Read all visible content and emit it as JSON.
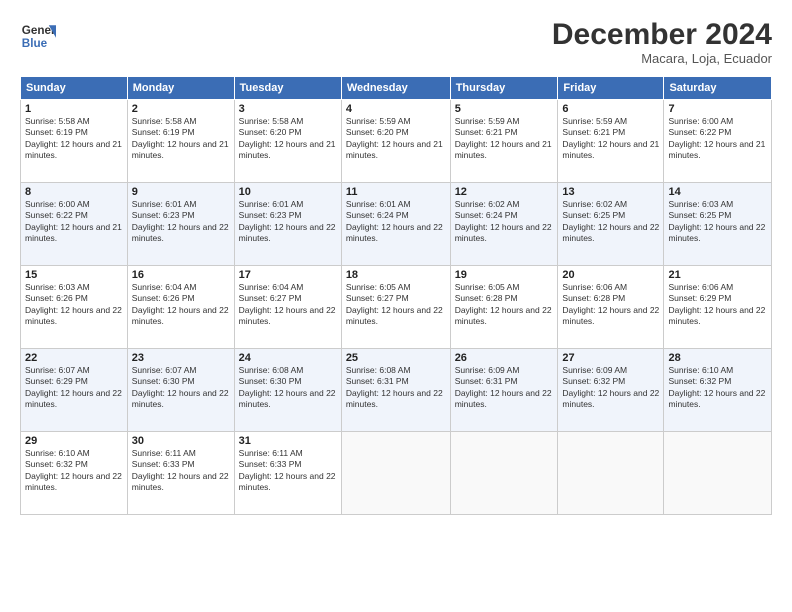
{
  "logo": {
    "line1": "General",
    "line2": "Blue"
  },
  "title": "December 2024",
  "subtitle": "Macara, Loja, Ecuador",
  "days_header": [
    "Sunday",
    "Monday",
    "Tuesday",
    "Wednesday",
    "Thursday",
    "Friday",
    "Saturday"
  ],
  "weeks": [
    [
      {
        "day": "1",
        "sunrise": "5:58 AM",
        "sunset": "6:19 PM",
        "daylight": "12 hours and 21 minutes."
      },
      {
        "day": "2",
        "sunrise": "5:58 AM",
        "sunset": "6:19 PM",
        "daylight": "12 hours and 21 minutes."
      },
      {
        "day": "3",
        "sunrise": "5:58 AM",
        "sunset": "6:20 PM",
        "daylight": "12 hours and 21 minutes."
      },
      {
        "day": "4",
        "sunrise": "5:59 AM",
        "sunset": "6:20 PM",
        "daylight": "12 hours and 21 minutes."
      },
      {
        "day": "5",
        "sunrise": "5:59 AM",
        "sunset": "6:21 PM",
        "daylight": "12 hours and 21 minutes."
      },
      {
        "day": "6",
        "sunrise": "5:59 AM",
        "sunset": "6:21 PM",
        "daylight": "12 hours and 21 minutes."
      },
      {
        "day": "7",
        "sunrise": "6:00 AM",
        "sunset": "6:22 PM",
        "daylight": "12 hours and 21 minutes."
      }
    ],
    [
      {
        "day": "8",
        "sunrise": "6:00 AM",
        "sunset": "6:22 PM",
        "daylight": "12 hours and 21 minutes."
      },
      {
        "day": "9",
        "sunrise": "6:01 AM",
        "sunset": "6:23 PM",
        "daylight": "12 hours and 22 minutes."
      },
      {
        "day": "10",
        "sunrise": "6:01 AM",
        "sunset": "6:23 PM",
        "daylight": "12 hours and 22 minutes."
      },
      {
        "day": "11",
        "sunrise": "6:01 AM",
        "sunset": "6:24 PM",
        "daylight": "12 hours and 22 minutes."
      },
      {
        "day": "12",
        "sunrise": "6:02 AM",
        "sunset": "6:24 PM",
        "daylight": "12 hours and 22 minutes."
      },
      {
        "day": "13",
        "sunrise": "6:02 AM",
        "sunset": "6:25 PM",
        "daylight": "12 hours and 22 minutes."
      },
      {
        "day": "14",
        "sunrise": "6:03 AM",
        "sunset": "6:25 PM",
        "daylight": "12 hours and 22 minutes."
      }
    ],
    [
      {
        "day": "15",
        "sunrise": "6:03 AM",
        "sunset": "6:26 PM",
        "daylight": "12 hours and 22 minutes."
      },
      {
        "day": "16",
        "sunrise": "6:04 AM",
        "sunset": "6:26 PM",
        "daylight": "12 hours and 22 minutes."
      },
      {
        "day": "17",
        "sunrise": "6:04 AM",
        "sunset": "6:27 PM",
        "daylight": "12 hours and 22 minutes."
      },
      {
        "day": "18",
        "sunrise": "6:05 AM",
        "sunset": "6:27 PM",
        "daylight": "12 hours and 22 minutes."
      },
      {
        "day": "19",
        "sunrise": "6:05 AM",
        "sunset": "6:28 PM",
        "daylight": "12 hours and 22 minutes."
      },
      {
        "day": "20",
        "sunrise": "6:06 AM",
        "sunset": "6:28 PM",
        "daylight": "12 hours and 22 minutes."
      },
      {
        "day": "21",
        "sunrise": "6:06 AM",
        "sunset": "6:29 PM",
        "daylight": "12 hours and 22 minutes."
      }
    ],
    [
      {
        "day": "22",
        "sunrise": "6:07 AM",
        "sunset": "6:29 PM",
        "daylight": "12 hours and 22 minutes."
      },
      {
        "day": "23",
        "sunrise": "6:07 AM",
        "sunset": "6:30 PM",
        "daylight": "12 hours and 22 minutes."
      },
      {
        "day": "24",
        "sunrise": "6:08 AM",
        "sunset": "6:30 PM",
        "daylight": "12 hours and 22 minutes."
      },
      {
        "day": "25",
        "sunrise": "6:08 AM",
        "sunset": "6:31 PM",
        "daylight": "12 hours and 22 minutes."
      },
      {
        "day": "26",
        "sunrise": "6:09 AM",
        "sunset": "6:31 PM",
        "daylight": "12 hours and 22 minutes."
      },
      {
        "day": "27",
        "sunrise": "6:09 AM",
        "sunset": "6:32 PM",
        "daylight": "12 hours and 22 minutes."
      },
      {
        "day": "28",
        "sunrise": "6:10 AM",
        "sunset": "6:32 PM",
        "daylight": "12 hours and 22 minutes."
      }
    ],
    [
      {
        "day": "29",
        "sunrise": "6:10 AM",
        "sunset": "6:32 PM",
        "daylight": "12 hours and 22 minutes."
      },
      {
        "day": "30",
        "sunrise": "6:11 AM",
        "sunset": "6:33 PM",
        "daylight": "12 hours and 22 minutes."
      },
      {
        "day": "31",
        "sunrise": "6:11 AM",
        "sunset": "6:33 PM",
        "daylight": "12 hours and 22 minutes."
      },
      null,
      null,
      null,
      null
    ]
  ]
}
